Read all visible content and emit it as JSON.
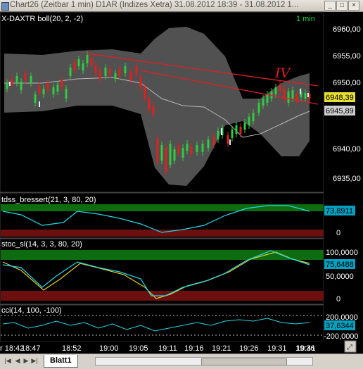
{
  "window": {
    "title": "Chart26 (Zeitbar 1 min)  D1AR (Indizes Xetra) 31.08.2012 18:39 - 31.08.2012 1...",
    "min_glyph": "_",
    "max_glyph": "□",
    "close_glyph": "×"
  },
  "panels": {
    "price": {
      "label": "X-DAXTR boll(20, 2, -2)",
      "interval": "1 min",
      "axis_ticks": [
        "6960,00",
        "6955,00",
        "6950,00",
        "6940,00",
        "6935,00"
      ],
      "last_price": "6948,39",
      "band_value": "6945,89",
      "annotation": "IV"
    },
    "tdss": {
      "label": "tdss_bressert(21, 3, 80, 20)",
      "value": "73,8911",
      "axis_ticks": [
        "0"
      ]
    },
    "stoc": {
      "label": "stoc_sl(14, 3, 3, 80, 20)",
      "value": "75,6488",
      "axis_ticks": [
        "100,0000",
        "50,0000",
        "0"
      ]
    },
    "cci": {
      "label": "cci(14, 100, -100)",
      "value": "37,6344",
      "axis_ticks": [
        "200,0000",
        "-200,0000"
      ]
    }
  },
  "time_axis": [
    "r 18:42",
    "18:47",
    "18:52",
    "19:00",
    "19:05",
    "19:11",
    "19:16",
    "19:21",
    "19:26",
    "19:31",
    "19:36",
    "19:41"
  ],
  "sheet_tab": "Blatt1",
  "nav": {
    "first": "|◀",
    "prev": "◀",
    "next": "▶",
    "last": "▶|"
  },
  "colors": {
    "background": "#000000",
    "band": "#5a5a5a",
    "candle_up": "#2ecc40",
    "candle_down": "#e02020",
    "trendline": "#e02020",
    "overbought_zone": "#0f6b0f",
    "oversold_zone": "#6b0f0f",
    "indicator_line": "#22d8e8",
    "stoc_signal": "#e8d020",
    "label_text": "#ffffff",
    "interval_text": "#20d040",
    "value_badge": "#00a0c0",
    "last_price_badge": "#e8e030"
  }
}
